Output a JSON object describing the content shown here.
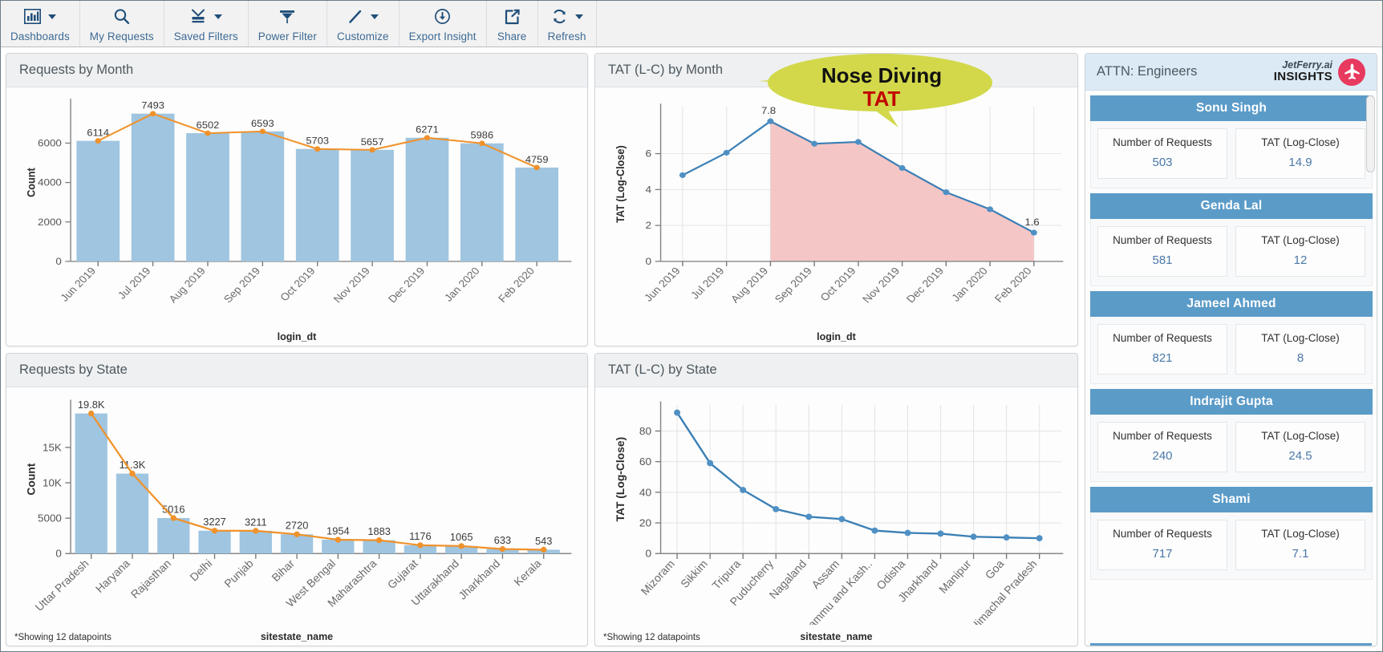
{
  "toolbar": {
    "items": [
      {
        "label": "Dashboards",
        "icon": "bar-chart-icon",
        "caret": true
      },
      {
        "label": "My Requests",
        "icon": "search-icon",
        "caret": false
      },
      {
        "label": "Saved Filters",
        "icon": "save-filter-icon",
        "caret": true
      },
      {
        "label": "Power Filter",
        "icon": "funnel-icon",
        "caret": false
      },
      {
        "label": "Customize",
        "icon": "pencil-icon",
        "caret": true
      },
      {
        "label": "Export Insight",
        "icon": "download-icon",
        "caret": false
      },
      {
        "label": "Share",
        "icon": "share-icon",
        "caret": false
      },
      {
        "label": "Refresh",
        "icon": "refresh-icon",
        "caret": true
      }
    ]
  },
  "panels": {
    "requests_by_month": {
      "title": "Requests by Month",
      "axis_label": "login_dt"
    },
    "tat_by_month": {
      "title": "TAT (L-C) by Month",
      "axis_label": "login_dt"
    },
    "requests_by_state": {
      "title": "Requests by State",
      "axis_label": "sitestate_name",
      "note": "*Showing 12 datapoints"
    },
    "tat_by_state": {
      "title": "TAT (L-C) by State",
      "axis_label": "sitestate_name",
      "note": "*Showing 12 datapoints"
    }
  },
  "callout": {
    "line1": "Nose Diving",
    "line2": "TAT",
    "fill": "#d2d84a"
  },
  "insights": {
    "title": "ATTN: Engineers",
    "brand_name": "JetFerry.ai",
    "brand_sub": "INSIGHTS",
    "brand_color": "#e8395e",
    "metric_labels": {
      "requests": "Number of Requests",
      "tat": "TAT (Log-Close)"
    },
    "engineers": [
      {
        "name": "Sonu Singh",
        "requests": "503",
        "tat": "14.9"
      },
      {
        "name": "Genda Lal",
        "requests": "581",
        "tat": "12"
      },
      {
        "name": "Jameel Ahmed",
        "requests": "821",
        "tat": "8"
      },
      {
        "name": "Indrajit Gupta",
        "requests": "240",
        "tat": "24.5"
      },
      {
        "name": "Shami",
        "requests": "717",
        "tat": "7.1"
      }
    ]
  },
  "chart_data": [
    {
      "id": "requests_by_month",
      "type": "bar",
      "title": "Requests by Month",
      "xlabel": "login_dt",
      "ylabel": "Count",
      "categories": [
        "Jun 2019",
        "Jul 2019",
        "Aug 2019",
        "Sep 2019",
        "Oct 2019",
        "Nov 2019",
        "Dec 2019",
        "Jan 2020",
        "Feb 2020"
      ],
      "values": [
        6114,
        7493,
        6502,
        6593,
        5703,
        5657,
        6271,
        5986,
        4759
      ],
      "data_labels": [
        "6114",
        "7493",
        "6502",
        "6593",
        "5703",
        "5657",
        "6271",
        "5986",
        "4759"
      ],
      "overlay_series": {
        "name": "trend",
        "values": [
          6114,
          7493,
          6502,
          6593,
          5703,
          5657,
          6271,
          5986,
          4759
        ],
        "color": "#f0922b"
      },
      "bar_color": "#9fc5e0",
      "yticks": [
        0,
        2000,
        4000,
        6000
      ],
      "ytick_labels": [
        "0",
        "2000",
        "4000",
        "6000"
      ],
      "ylim": [
        0,
        8000
      ],
      "grid": false
    },
    {
      "id": "tat_by_month",
      "type": "area",
      "title": "TAT (L-C) by Month",
      "xlabel": "login_dt",
      "ylabel": "TAT (Log-Close)",
      "categories": [
        "Jun 2019",
        "Jul 2019",
        "Aug 2019",
        "Sep 2019",
        "Oct 2019",
        "Nov 2019",
        "Dec 2019",
        "Jan 2020",
        "Feb 2020"
      ],
      "values": [
        4.8,
        6.05,
        7.8,
        6.55,
        6.65,
        5.2,
        3.85,
        2.9,
        1.6
      ],
      "data_labels": {
        "Aug 2019": "7.8",
        "Feb 2020": "1.6"
      },
      "line_color": "#3a7fb5",
      "area_fill_color": "#f4c3c3",
      "area_fill_from": "Aug 2019",
      "yticks": [
        0,
        2,
        4,
        6
      ],
      "ytick_labels": [
        "0",
        "2",
        "4",
        "6"
      ],
      "ylim": [
        0,
        8.6
      ],
      "grid": true
    },
    {
      "id": "requests_by_state",
      "type": "bar",
      "title": "Requests by State",
      "xlabel": "sitestate_name",
      "ylabel": "Count",
      "categories": [
        "Uttar Pradesh",
        "Haryana",
        "Rajasthan",
        "Delhi",
        "Punjab",
        "Bihar",
        "West Bengal",
        "Maharashtra",
        "Gujarat",
        "Uttarakhand",
        "Jharkhand",
        "Kerala"
      ],
      "values": [
        19800,
        11300,
        5016,
        3227,
        3211,
        2720,
        1954,
        1883,
        1176,
        1065,
        633,
        543
      ],
      "data_labels": [
        "19.8K",
        "11.3K",
        "5016",
        "3227",
        "3211",
        "2720",
        "1954",
        "1883",
        "1176",
        "1065",
        "633",
        "543"
      ],
      "overlay_series": {
        "name": "trend",
        "values": [
          19800,
          11300,
          5016,
          3227,
          3211,
          2720,
          1954,
          1883,
          1176,
          1065,
          633,
          543
        ],
        "color": "#f0922b"
      },
      "bar_color": "#9fc5e0",
      "yticks": [
        0,
        5000,
        10000,
        15000
      ],
      "ytick_labels": [
        "0",
        "5000",
        "10K",
        "15K"
      ],
      "ylim": [
        0,
        21000
      ],
      "grid": false,
      "note": "*Showing 12 datapoints"
    },
    {
      "id": "tat_by_state",
      "type": "line",
      "title": "TAT (L-C) by State",
      "xlabel": "sitestate_name",
      "ylabel": "TAT (Log-Close)",
      "categories": [
        "Mizoram",
        "Sikkim",
        "Tripura",
        "Puducherry",
        "Nagaland",
        "Assam",
        "Jammu and Kash..",
        "Odisha",
        "Jharkhand",
        "Manipur",
        "Goa",
        "Himachal Pradesh"
      ],
      "values": [
        92,
        59,
        41.5,
        29,
        24,
        22.5,
        15,
        13.5,
        13,
        11,
        10.5,
        10
      ],
      "line_color": "#3a7fb5",
      "yticks": [
        0,
        20,
        40,
        60,
        80
      ],
      "ytick_labels": [
        "0",
        "20",
        "40",
        "60",
        "80"
      ],
      "ylim": [
        0,
        97
      ],
      "grid": true,
      "note": "*Showing 12 datapoints"
    }
  ]
}
